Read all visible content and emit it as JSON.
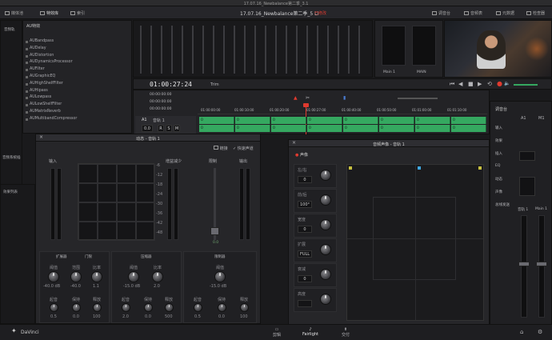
{
  "window_title": "17.07.16_Newbalance第二季_3.1",
  "project_title": "17.07.16_Newbalance第二季_5 Li",
  "project_status": "已修改",
  "toolbar_left": [
    "媒体池",
    "特效库",
    "索引"
  ],
  "toolbar_right": [
    "调音台",
    "音频表",
    "元数据",
    "检查器"
  ],
  "effects_panel_title": "AU特效",
  "panel_label_left": "音频轨",
  "effects_list": [
    "AUBandpass",
    "AUDelay",
    "AUDistortion",
    "AUDynamicsProcessor",
    "AUFilter",
    "AUGraphicEQ",
    "AUHighShelfFilter",
    "AUHipass",
    "AULowpass",
    "AULowShelfFilter",
    "AUMatrixReverb",
    "AUMultibandCompressor"
  ],
  "side_labels": [
    "音频系统插",
    "效果列表",
    "音轨"
  ],
  "timecode": "01:00:27:24",
  "mode": "Trim",
  "transport_times": [
    "00:00:00:00",
    "00:00:00:00",
    "00:00:00:00"
  ],
  "ruler_ticks": [
    "01:00:00:00",
    "01:00:10:00",
    "01:00:20:00",
    "01:00:27:00",
    "01:00:40:00",
    "01:00:50:00",
    "01:01:00:00",
    "01:01:10:00"
  ],
  "track": {
    "name": "A1",
    "label": "音轨 1",
    "volume": "0.0",
    "buttons": [
      "R",
      "S",
      "M"
    ]
  },
  "clip_labels": [
    "0",
    "0",
    "0",
    "0",
    "0",
    "0",
    "0",
    "0"
  ],
  "dynamics": {
    "title": "动态 - 音轨 1",
    "checkbox1": "链接",
    "checkbox2": "快速声道",
    "section_input": "输入",
    "section_gain": "增益减少",
    "section_limit": "限制",
    "section_output": "输出",
    "graph_ticks": [
      "-6",
      "-12",
      "-18",
      "-24",
      "-30",
      "-36",
      "-42",
      "-48"
    ],
    "gain_value": "0.0",
    "groups": [
      {
        "title": "扩展器",
        "switch": "门限",
        "labels": [
          "阈值",
          "范围",
          "比率"
        ],
        "values": [
          "-40.0 dB",
          "-40.0",
          "1.1"
        ],
        "labels2": [
          "起音",
          "保持",
          "释放"
        ],
        "values2": [
          "0.5",
          "0.0",
          "100"
        ]
      },
      {
        "title": "压缩器",
        "labels": [
          "阈值",
          "比率"
        ],
        "values": [
          "-15.0 dB",
          "2.0"
        ],
        "labels2": [
          "起音",
          "保持",
          "释放"
        ],
        "values2": [
          "2.0",
          "0.0",
          "500"
        ]
      },
      {
        "title": "限制器",
        "labels": [
          "阈值"
        ],
        "values": [
          "-15.0 dB"
        ],
        "labels2": [
          "起音",
          "保持",
          "释放"
        ],
        "values2": [
          "0.5",
          "0.0",
          "100"
        ]
      }
    ]
  },
  "eq": {
    "title": "音频声像 - 音轨 1",
    "header": "声像",
    "rows": [
      {
        "label": "左/右",
        "value": "0"
      },
      {
        "label": "前/后",
        "value": "100°"
      },
      {
        "label": "宽度",
        "value": "0"
      },
      {
        "label": "扩展",
        "value": "FULL"
      },
      {
        "label": "衰减",
        "value": "0"
      },
      {
        "label": "高度",
        "value": ""
      }
    ]
  },
  "meter_right": {
    "header": "调音台",
    "tracks": [
      "A1",
      "M1"
    ],
    "labels": [
      "输入",
      "效果",
      "插入",
      "EQ",
      "动态",
      "声像",
      "总线发送"
    ],
    "fader_labels": [
      "音轨 1",
      "Main 1"
    ]
  },
  "buses": [
    "Main 1",
    "MAIN"
  ],
  "bottom_tabs": [
    "剪辑",
    "Fairlight",
    "交付"
  ],
  "logo_text": "DaVinci",
  "colors": {
    "accent_green": "#35a860",
    "playhead_red": "#e03a2f",
    "accent_blue": "#4a7bd0",
    "panel": "#232326"
  }
}
